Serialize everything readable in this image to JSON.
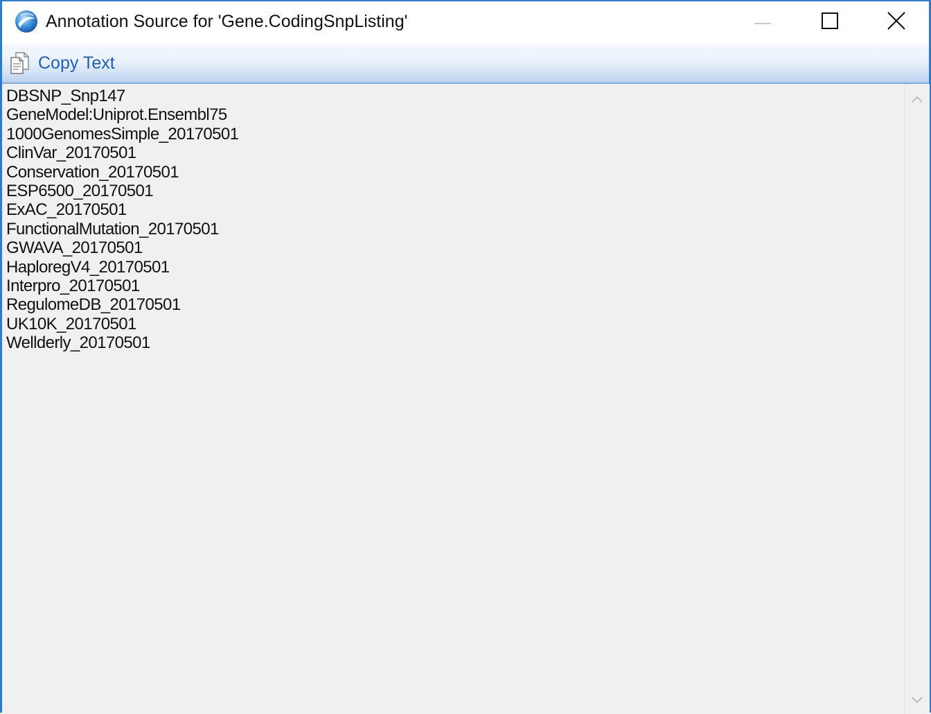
{
  "window": {
    "title": "Annotation Source for 'Gene.CodingSnpListing'",
    "icon": "app-globe-icon",
    "controls": [
      "minimize-icon",
      "maximize-icon",
      "close-icon"
    ]
  },
  "toolbar": {
    "copy_text_label": "Copy Text",
    "copy_icon": "copy-document-icon"
  },
  "content": {
    "lines": [
      "DBSNP_Snp147",
      "GeneModel:Uniprot.Ensembl75",
      "1000GenomesSimple_20170501",
      "ClinVar_20170501",
      "Conservation_20170501",
      "ESP6500_20170501",
      "ExAC_20170501",
      "FunctionalMutation_20170501",
      "GWAVA_20170501",
      "HaploregV4_20170501",
      "Interpro_20170501",
      "RegulomeDB_20170501",
      "UK10K_20170501",
      "Wellderly_20170501"
    ]
  },
  "colors": {
    "window_border": "#2b7bd6",
    "toolbar_link": "#1f5fb8",
    "content_background": "#f0f0f0"
  }
}
